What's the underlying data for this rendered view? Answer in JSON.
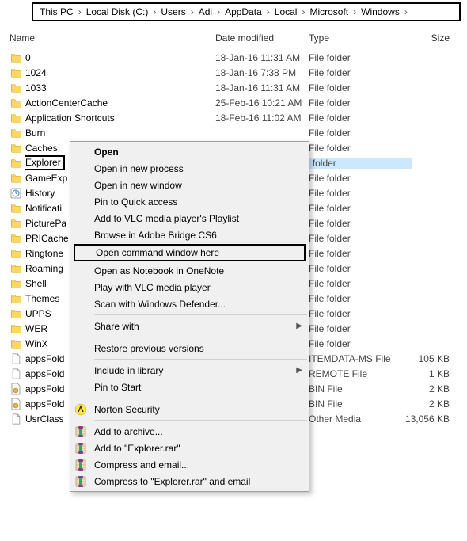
{
  "breadcrumb": [
    "This PC",
    "Local Disk (C:)",
    "Users",
    "Adi",
    "AppData",
    "Local",
    "Microsoft",
    "Windows"
  ],
  "columns": {
    "name": "Name",
    "date": "Date modified",
    "type": "Type",
    "size": "Size"
  },
  "rows": [
    {
      "icon": "folder",
      "name": "0",
      "date": "18-Jan-16 11:31 AM",
      "type": "File folder",
      "size": ""
    },
    {
      "icon": "folder",
      "name": "1024",
      "date": "18-Jan-16 7:38 PM",
      "type": "File folder",
      "size": ""
    },
    {
      "icon": "folder",
      "name": "1033",
      "date": "18-Jan-16 11:31 AM",
      "type": "File folder",
      "size": ""
    },
    {
      "icon": "folder",
      "name": "ActionCenterCache",
      "date": "25-Feb-16 10:21 AM",
      "type": "File folder",
      "size": ""
    },
    {
      "icon": "folder",
      "name": "Application Shortcuts",
      "date": "18-Feb-16 11:02 AM",
      "type": "File folder",
      "size": ""
    },
    {
      "icon": "folder",
      "name": "Burn",
      "date": "",
      "type": "File folder",
      "size": ""
    },
    {
      "icon": "folder",
      "name": "Caches",
      "date": "",
      "type": "File folder",
      "size": ""
    },
    {
      "icon": "folder",
      "name": "Explorer",
      "date": "",
      "type": "File folder",
      "size": "",
      "selected": true,
      "boxed": true
    },
    {
      "icon": "folder",
      "name": "GameExp",
      "date": "",
      "type": "File folder",
      "size": "",
      "truncated": true
    },
    {
      "icon": "history",
      "name": "History",
      "date": "",
      "type": "File folder",
      "size": ""
    },
    {
      "icon": "folder",
      "name": "Notificati",
      "date": "",
      "type": "File folder",
      "size": "",
      "truncated": true
    },
    {
      "icon": "folder",
      "name": "PicturePa",
      "date": "",
      "type": "File folder",
      "size": "",
      "truncated": true
    },
    {
      "icon": "folder",
      "name": "PRICache",
      "date": "",
      "type": "File folder",
      "size": ""
    },
    {
      "icon": "folder",
      "name": "Ringtone",
      "date": "",
      "type": "File folder",
      "size": "",
      "truncated": true
    },
    {
      "icon": "folder",
      "name": "Roaming",
      "date": "",
      "type": "File folder",
      "size": "",
      "truncated": true
    },
    {
      "icon": "folder",
      "name": "Shell",
      "date": "",
      "type": "File folder",
      "size": ""
    },
    {
      "icon": "folder",
      "name": "Themes",
      "date": "",
      "type": "File folder",
      "size": ""
    },
    {
      "icon": "folder",
      "name": "UPPS",
      "date": "",
      "type": "File folder",
      "size": ""
    },
    {
      "icon": "folder",
      "name": "WER",
      "date": "",
      "type": "File folder",
      "size": ""
    },
    {
      "icon": "folder",
      "name": "WinX",
      "date": "",
      "type": "File folder",
      "size": ""
    },
    {
      "icon": "file",
      "name": "appsFold",
      "date": "",
      "type": "ITEMDATA-MS File",
      "size": "105 KB",
      "truncated": true
    },
    {
      "icon": "file",
      "name": "appsFold",
      "date": "",
      "type": "REMOTE File",
      "size": "1 KB",
      "truncated": true
    },
    {
      "icon": "bin",
      "name": "appsFold",
      "date": "",
      "type": "BIN File",
      "size": "2 KB",
      "truncated": true
    },
    {
      "icon": "bin",
      "name": "appsFold",
      "date": "",
      "type": "BIN File",
      "size": "2 KB",
      "truncated": true
    },
    {
      "icon": "file",
      "name": "UsrClass",
      "date": "",
      "type": "Other Media",
      "size": "13,056 KB",
      "truncated": true
    }
  ],
  "menu": [
    {
      "label": "Open",
      "bold": true
    },
    {
      "label": "Open in new process"
    },
    {
      "label": "Open in new window"
    },
    {
      "label": "Pin to Quick access"
    },
    {
      "label": "Add to VLC media player's Playlist"
    },
    {
      "label": "Browse in Adobe Bridge CS6"
    },
    {
      "label": "Open command window here",
      "highlight_box": true
    },
    {
      "label": "Open as Notebook in OneNote"
    },
    {
      "label": "Play with VLC media player"
    },
    {
      "label": "Scan with Windows Defender..."
    },
    {
      "sep": true
    },
    {
      "label": "Share with",
      "submenu": true
    },
    {
      "sep": true
    },
    {
      "label": "Restore previous versions"
    },
    {
      "sep": true
    },
    {
      "label": "Include in library",
      "submenu": true
    },
    {
      "label": "Pin to Start"
    },
    {
      "sep": true
    },
    {
      "label": "Norton Security",
      "icon": "norton"
    },
    {
      "sep": true
    },
    {
      "label": "Add to archive...",
      "icon": "rar"
    },
    {
      "label": "Add to \"Explorer.rar\"",
      "icon": "rar"
    },
    {
      "label": "Compress and email...",
      "icon": "rar"
    },
    {
      "label": "Compress to \"Explorer.rar\" and email",
      "icon": "rar"
    }
  ]
}
